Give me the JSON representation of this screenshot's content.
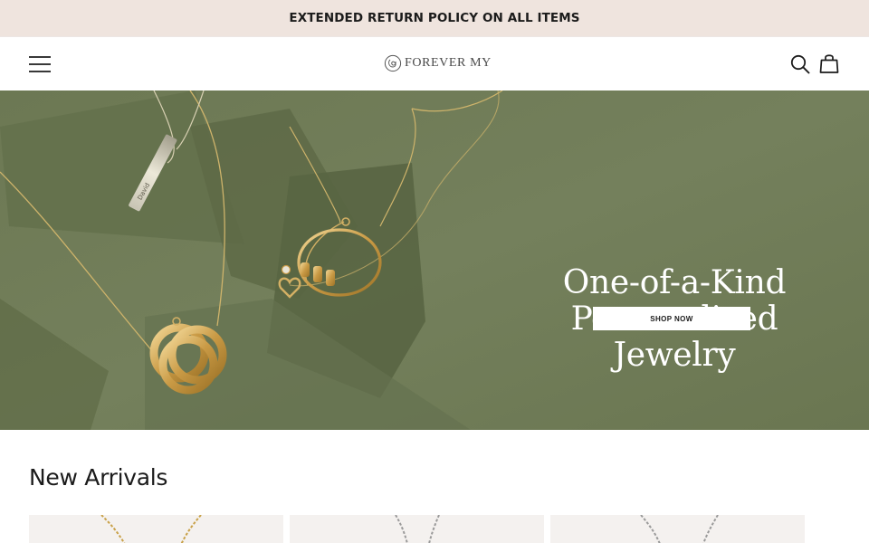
{
  "announcement": {
    "text": "EXTENDED RETURN POLICY ON ALL ITEMS"
  },
  "header": {
    "logo_text": "FOREVER MY",
    "icons": {
      "menu": "hamburger-menu-icon",
      "search": "search-icon",
      "cart": "shopping-bag-icon"
    }
  },
  "hero": {
    "title_lines": [
      "One-of-a-Kind",
      "Personalized",
      "Jewelry"
    ],
    "cta_label": "SHOP NOW",
    "engraving": "David",
    "background_color": "#6f7a57"
  },
  "new_arrivals": {
    "title": "New Arrivals",
    "products": [
      {
        "metal": "gold"
      },
      {
        "metal": "silver"
      },
      {
        "metal": "silver"
      }
    ]
  }
}
